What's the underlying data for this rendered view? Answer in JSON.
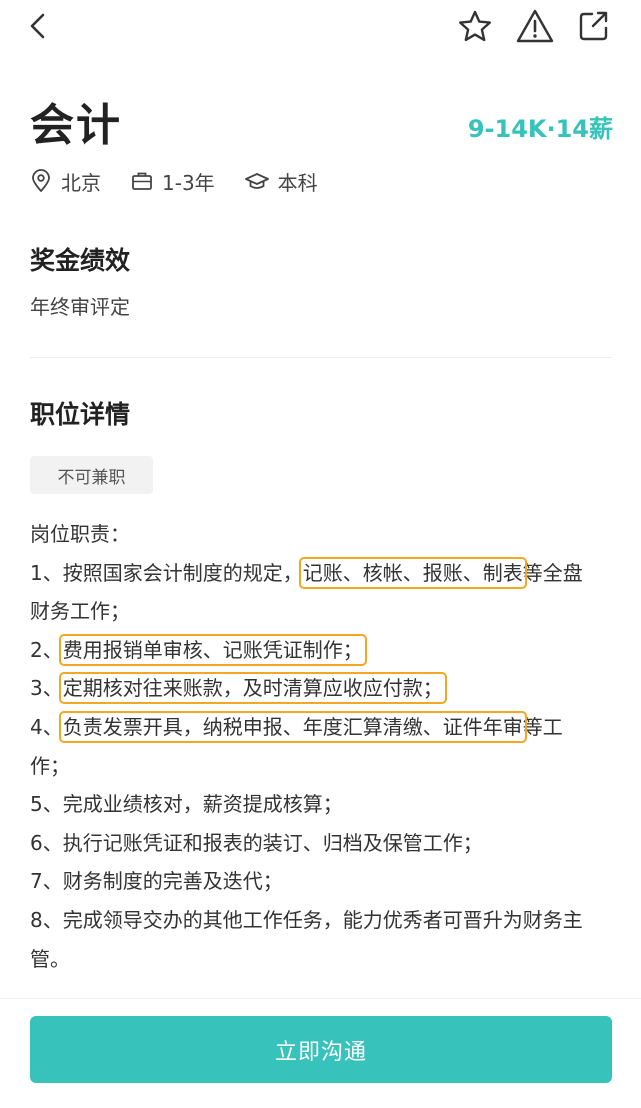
{
  "icons": {
    "back": "chevron-left-icon",
    "favorite": "star-icon",
    "report": "warning-icon",
    "share": "share-icon",
    "location": "location-pin-icon",
    "experience": "briefcase-icon",
    "education": "graduation-cap-icon"
  },
  "colors": {
    "accent": "#37c2bc",
    "highlight": "#f5a623"
  },
  "job": {
    "title": "会计",
    "salary": "9-14K·14薪",
    "location": "北京",
    "experience": "1-3年",
    "education": "本科"
  },
  "bonus": {
    "heading": "奖金绩效",
    "text": "年终审评定"
  },
  "details": {
    "heading": "职位详情",
    "tag": "不可兼职",
    "intro": "岗位职责：",
    "l1": {
      "pre": "1、按照国家会计制度的规定，",
      "hl": "记账、核帐、报账、制表",
      "post": "等全盘"
    },
    "l1b": "财务工作；",
    "l2": {
      "pre": "2、",
      "hl": "费用报销单审核、记账凭证制作；"
    },
    "l3": {
      "pre": "3、",
      "hl": "定期核对往来账款，及时清算应收应付款；"
    },
    "l4": {
      "pre": "4、",
      "hl": "负责发票开具，纳税申报、年度汇算清缴、证件年审",
      "post": "等工"
    },
    "l4b": "作；",
    "l5": "5、完成业绩核对，薪资提成核算；",
    "l6": "6、执行记账凭证和报表的装订、归档及保管工作；",
    "l7": "7、财务制度的完善及迭代；",
    "l8a": "8、完成领导交办的其他工作任务，能力优秀者可晋升为财务主",
    "l8b": "管。"
  },
  "cta": {
    "label": "立即沟通"
  }
}
